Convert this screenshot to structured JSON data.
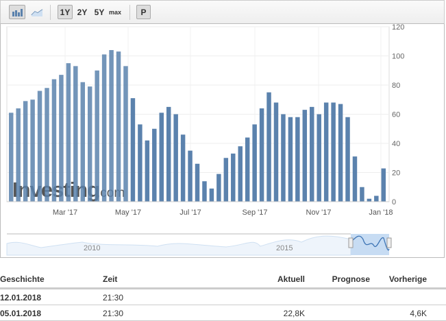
{
  "toolbar": {
    "bar_icon": "bar-chart-icon",
    "line_icon": "line-chart-icon",
    "ranges": [
      "1Y",
      "2Y",
      "5Y",
      "max"
    ],
    "active": "1Y",
    "p_label": "P"
  },
  "watermark": {
    "brand": "Investing",
    "suffix": ".com"
  },
  "navigator": {
    "labels": [
      "2010",
      "2015"
    ]
  },
  "chart_data": {
    "type": "bar",
    "title": "",
    "xlabel": "",
    "ylabel": "",
    "ylim": [
      0,
      120
    ],
    "yticks": [
      "0",
      "20",
      "40",
      "60",
      "80",
      "100",
      "120"
    ],
    "xtick_labels": [
      "Mar '17",
      "May '17",
      "Jul '17",
      "Sep '17",
      "Nov '17",
      "Jan '18"
    ],
    "color": "#5b82ad",
    "grid": true,
    "values": [
      61,
      64,
      69,
      70,
      76,
      78,
      84,
      87,
      95,
      93,
      82,
      79,
      90,
      101,
      104,
      103,
      93,
      71,
      53,
      42,
      50,
      61,
      65,
      60,
      46,
      35,
      26,
      14,
      9,
      19,
      30,
      33,
      38,
      44,
      53,
      64,
      75,
      68,
      60,
      58,
      58,
      63,
      65,
      60,
      68,
      68,
      67,
      58,
      31,
      10,
      2,
      4,
      22.8
    ]
  },
  "history": {
    "headers": [
      "Geschichte",
      "Zeit",
      "Aktuell",
      "Prognose",
      "Vorherige"
    ],
    "rows": [
      {
        "date": "12.01.2018",
        "time": "21:30",
        "actual": "",
        "forecast": "",
        "previous": ""
      },
      {
        "date": "05.01.2018",
        "time": "21:30",
        "actual": "22,8K",
        "forecast": "",
        "previous": "4,6K"
      }
    ]
  }
}
